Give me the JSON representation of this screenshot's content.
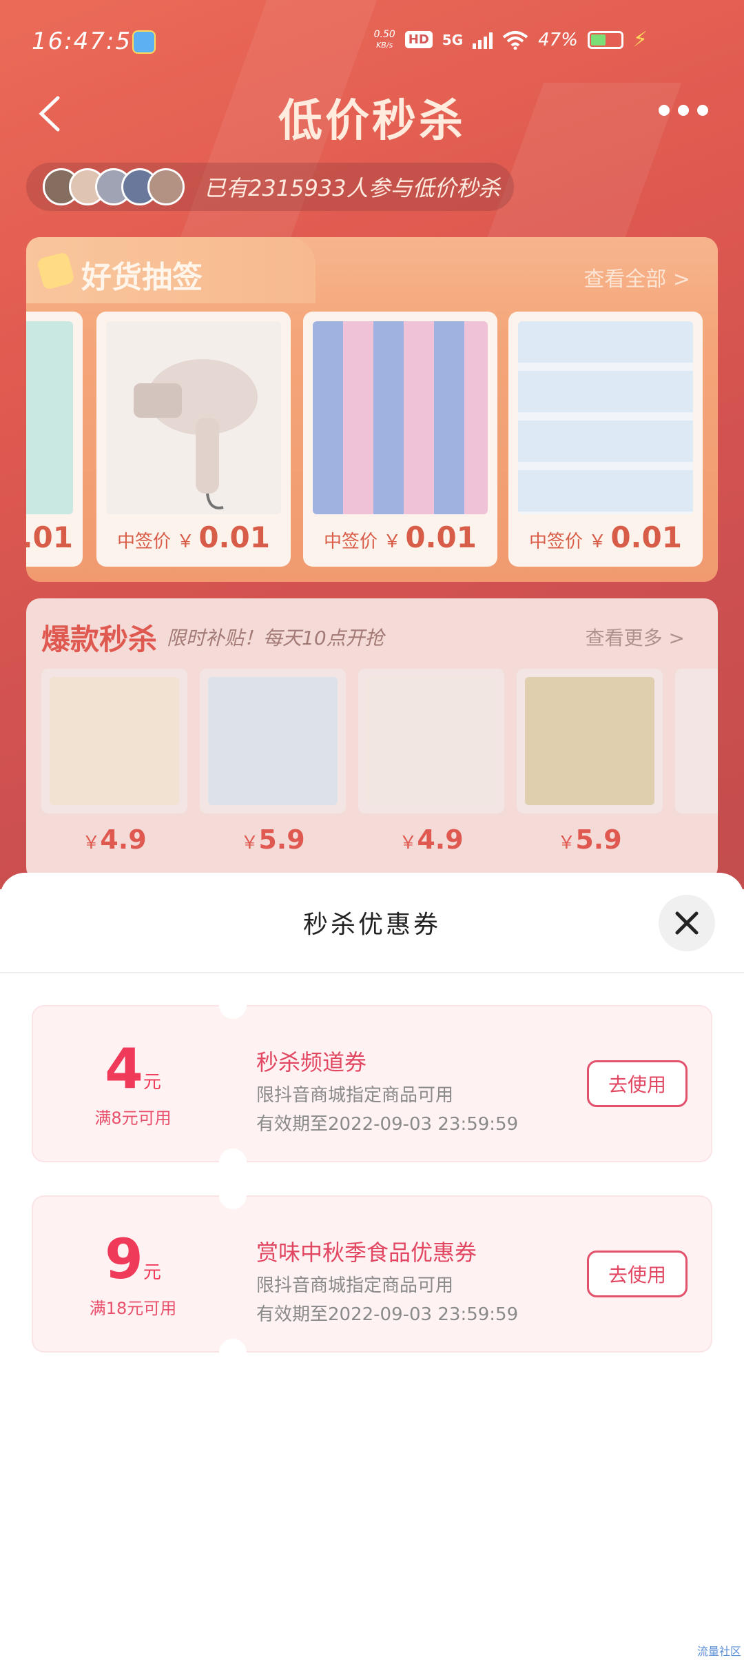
{
  "status_bar": {
    "time": "16:47:50",
    "speed": "0.50",
    "speed_unit": "KB/s",
    "hd": "HD",
    "network": "5G",
    "battery": "47%",
    "battery_level": 0.47
  },
  "header": {
    "title": "低价秒杀",
    "participants_text": "已有2315933人参与低价秒杀"
  },
  "lottery": {
    "title": "好货抽签",
    "more_label": "查看全部 >",
    "items": [
      {
        "price_label": "",
        "price": ".01",
        "image_color": "#bfe3dc"
      },
      {
        "price_label": "中签价 ￥",
        "price": "0.01",
        "image_color": "#e9ddd8"
      },
      {
        "price_label": "中签价 ￥",
        "price": "0.01",
        "image_color": "#b8c8ea"
      },
      {
        "price_label": "中签价 ￥",
        "price": "0.01",
        "image_color": "#cfdff0"
      }
    ]
  },
  "hot_sale": {
    "title": "爆款秒杀",
    "subtitle": "限时补贴！每天10点开抢",
    "more_label": "查看更多 >",
    "items": [
      {
        "price_symbol": "￥",
        "price": "4.9",
        "image_color": "#f0d9c2"
      },
      {
        "price_symbol": "￥",
        "price": "5.9",
        "image_color": "#cfd6e6"
      },
      {
        "price_symbol": "￥",
        "price": "4.9",
        "image_color": "#e8cfc0"
      },
      {
        "price_symbol": "￥",
        "price": "5.9",
        "image_color": "#d9c49a"
      }
    ]
  },
  "sheet": {
    "title": "秒杀优惠券",
    "coupons": [
      {
        "amount": "4",
        "unit": "元",
        "condition": "满8元可用",
        "name": "秒杀频道券",
        "description": "限抖音商城指定商品可用",
        "expiry": "有效期至2022-09-03 23:59:59",
        "button": "去使用"
      },
      {
        "amount": "9",
        "unit": "元",
        "condition": "满18元可用",
        "name": "赏味中秋季食品优惠券",
        "description": "限抖音商城指定商品可用",
        "expiry": "有效期至2022-09-03 23:59:59",
        "button": "去使用"
      }
    ]
  },
  "watermark": "流量社区",
  "colors": {
    "brand_red": "#d8352a",
    "coupon_accent": "#f03a5a",
    "coupon_bg": "#fef2f3"
  }
}
